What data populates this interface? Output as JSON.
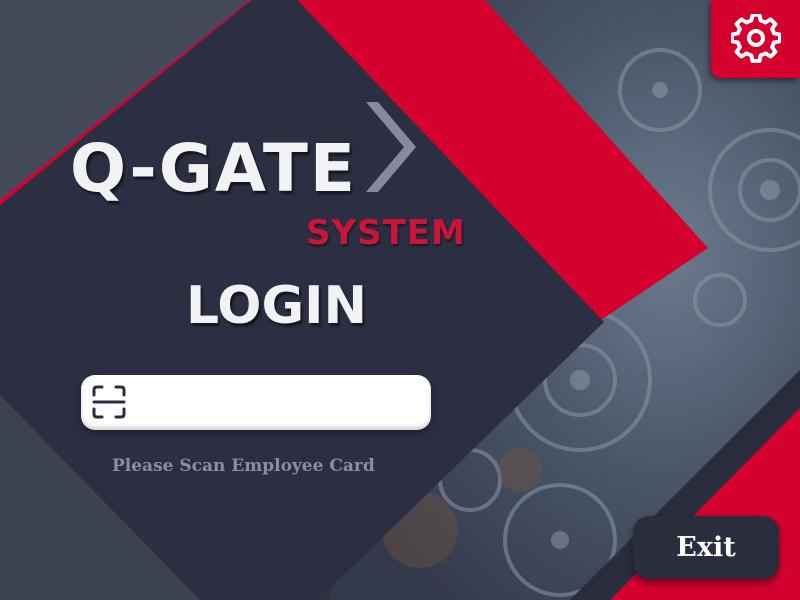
{
  "brand": {
    "logo_text": "Q-GATE",
    "logo_sub": "SYSTEM"
  },
  "login": {
    "title": "LOGIN",
    "scan_input_value": "",
    "scan_input_placeholder": "",
    "hint": "Please Scan Employee Card"
  },
  "toolbar": {
    "settings_icon": "gear-icon"
  },
  "actions": {
    "exit_label": "Exit"
  },
  "colors": {
    "accent": "#d4002e",
    "dark": "#2a2d3e",
    "panel": "#2c2f42"
  }
}
